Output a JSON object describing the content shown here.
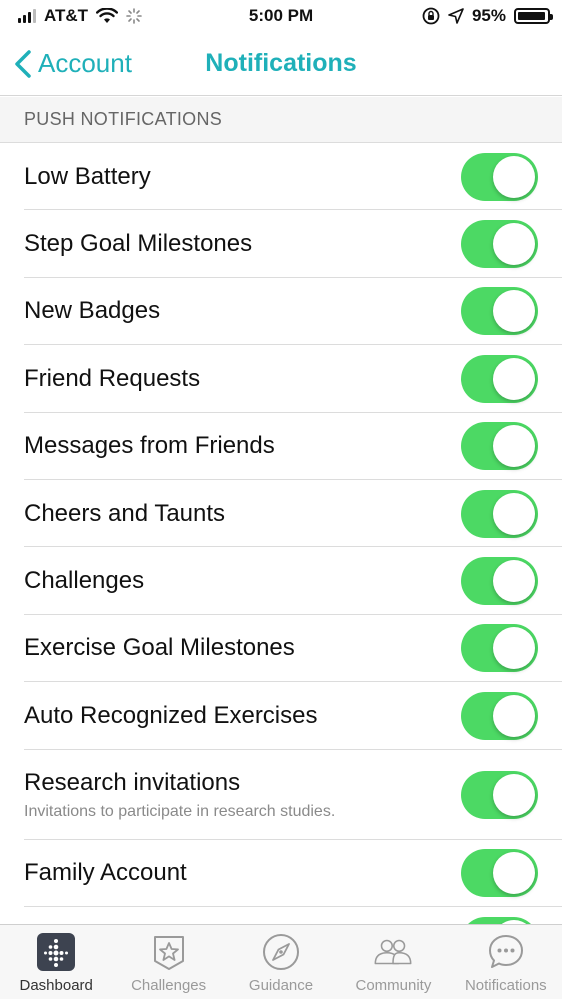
{
  "status_bar": {
    "carrier": "AT&T",
    "time": "5:00 PM",
    "battery": "95%",
    "battery_level": 0.95
  },
  "nav": {
    "back_label": "Account",
    "title": "Notifications"
  },
  "section": {
    "title": "PUSH NOTIFICATIONS"
  },
  "settings": [
    {
      "label": "Low Battery",
      "enabled": true
    },
    {
      "label": "Step Goal Milestones",
      "enabled": true
    },
    {
      "label": "New Badges",
      "enabled": true
    },
    {
      "label": "Friend Requests",
      "enabled": true
    },
    {
      "label": "Messages from Friends",
      "enabled": true
    },
    {
      "label": "Cheers and Taunts",
      "enabled": true
    },
    {
      "label": "Challenges",
      "enabled": true
    },
    {
      "label": "Exercise Goal Milestones",
      "enabled": true
    },
    {
      "label": "Auto Recognized Exercises",
      "enabled": true
    },
    {
      "label": "Research invitations",
      "sublabel": "Invitations to participate in research studies.",
      "enabled": true
    },
    {
      "label": "Family Account",
      "enabled": true
    }
  ],
  "tabs": [
    {
      "label": "Dashboard",
      "icon": "dashboard-icon",
      "active": true
    },
    {
      "label": "Challenges",
      "icon": "star-badge-icon",
      "active": false
    },
    {
      "label": "Guidance",
      "icon": "compass-icon",
      "active": false
    },
    {
      "label": "Community",
      "icon": "people-icon",
      "active": false
    },
    {
      "label": "Notifications",
      "icon": "chat-bubble-icon",
      "active": false
    }
  ],
  "colors": {
    "accent": "#1fb0b9",
    "toggle_on": "#4cd964"
  }
}
